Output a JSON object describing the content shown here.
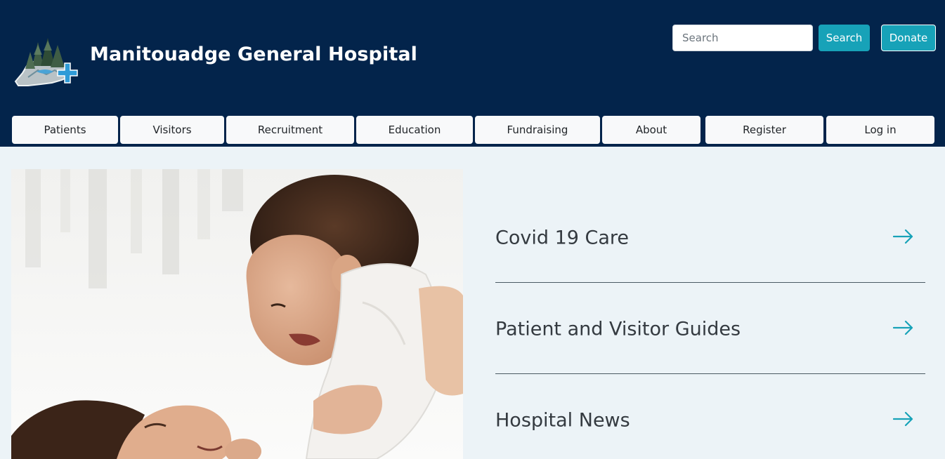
{
  "header": {
    "site_title": "Manitouadge General Hospital",
    "logo_icon": "hospital-logo-icon",
    "background_color": "#03244b"
  },
  "search": {
    "placeholder": "Search",
    "value": "",
    "button_label": "Search"
  },
  "donate": {
    "label": "Donate"
  },
  "accent_color": "#17a2b8",
  "nav": {
    "items": [
      {
        "label": "Patients"
      },
      {
        "label": "Visitors"
      },
      {
        "label": "Recruitment"
      },
      {
        "label": "Education"
      },
      {
        "label": "Fundraising"
      },
      {
        "label": "About"
      },
      {
        "label": "Register"
      },
      {
        "label": "Log in"
      }
    ]
  },
  "hero": {
    "image": "mother-lifting-baby-photo"
  },
  "links": {
    "items": [
      {
        "label": "Covid 19 Care",
        "icon": "arrow-right-icon"
      },
      {
        "label": "Patient and Visitor Guides",
        "icon": "arrow-right-icon"
      },
      {
        "label": "Hospital News",
        "icon": "arrow-right-icon"
      }
    ]
  }
}
